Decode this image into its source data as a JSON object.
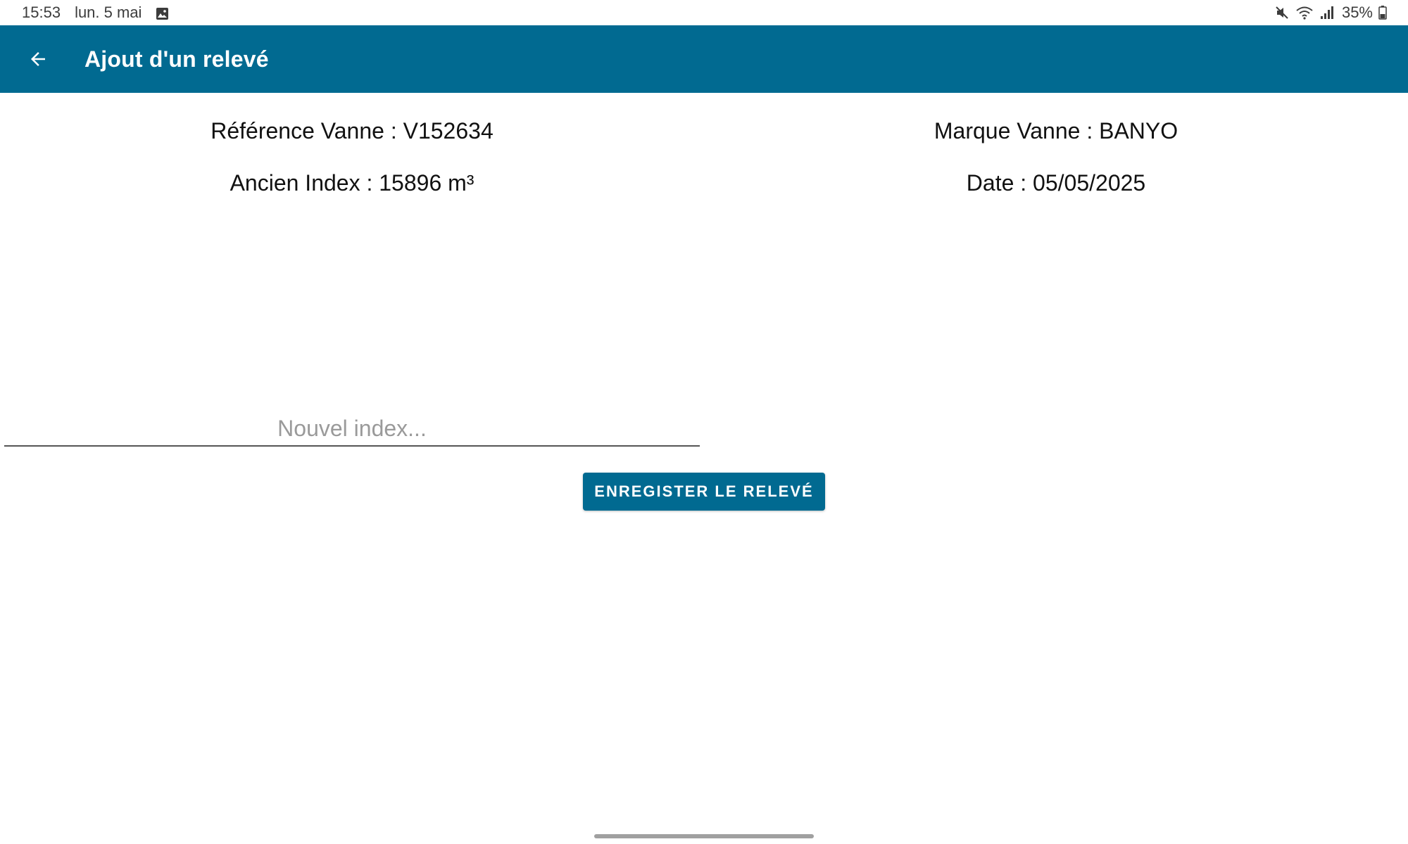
{
  "status_bar": {
    "time": "15:53",
    "date": "lun. 5 mai",
    "battery": "35%",
    "icons": [
      "gallery-icon",
      "mute-icon",
      "wifi-icon",
      "signal-icon",
      "battery-icon"
    ]
  },
  "app_bar": {
    "title": "Ajout d'un relevé",
    "back_icon": "arrow-back-icon",
    "background_color": "#016a91"
  },
  "info": {
    "reference": "Référence Vanne : V152634",
    "old_index": "Ancien Index : 15896 m³",
    "brand": "Marque Vanne : BANYO",
    "date": "Date : 05/05/2025"
  },
  "form": {
    "new_index_placeholder": "Nouvel index...",
    "new_index_value": "",
    "save_label": "ENREGISTER LE RELEVÉ"
  },
  "colors": {
    "accent": "#016a91",
    "placeholder": "#9a9a9a"
  }
}
